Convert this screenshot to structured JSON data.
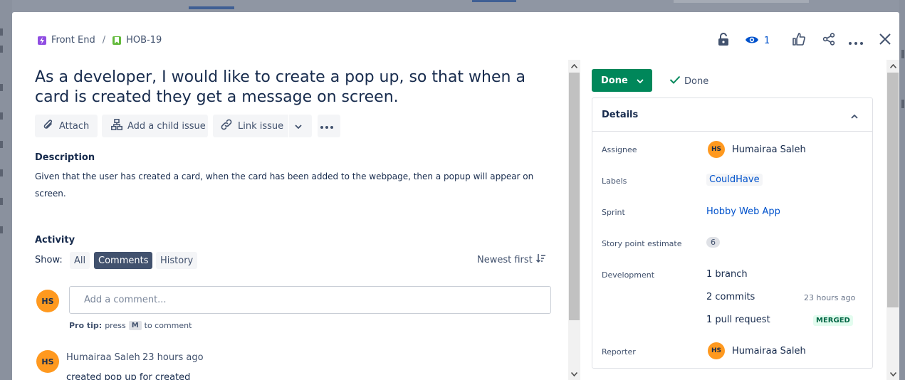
{
  "breadcrumb": {
    "project": "Front End",
    "separator": "/",
    "issue_key": "HOB-19"
  },
  "header_actions": {
    "watch_count": "1"
  },
  "issue": {
    "title": "As a developer, I would like to create a pop up, so that when a card is created they get a message on screen."
  },
  "toolbar": {
    "attach": "Attach",
    "add_child": "Add a child issue",
    "link_issue": "Link issue"
  },
  "description": {
    "heading": "Description",
    "text": "Given that the user has created a card, when the card has been added to the webpage, then a popup will appear on screen."
  },
  "activity": {
    "heading": "Activity",
    "show_label": "Show:",
    "filters": [
      "All",
      "Comments",
      "History"
    ],
    "active_filter": "Comments",
    "sort": "Newest first",
    "comment_placeholder": "Add a comment...",
    "protip_prefix": "Pro tip:",
    "protip_press": "press",
    "protip_key": "M",
    "protip_suffix": "to comment",
    "current_user_initials": "HS",
    "comments": [
      {
        "initials": "HS",
        "author": "Humairaa Saleh",
        "time": "23 hours ago",
        "body": "created pop up for created"
      }
    ]
  },
  "status": {
    "label": "Done",
    "resolution": "Done",
    "color": "#00875a"
  },
  "details": {
    "heading": "Details",
    "assignee_label": "Assignee",
    "assignee_initials": "HS",
    "assignee": "Humairaa Saleh",
    "labels_label": "Labels",
    "label_value": "CouldHave",
    "sprint_label": "Sprint",
    "sprint": "Hobby Web App",
    "story_points_label": "Story point estimate",
    "story_points": "6",
    "development_label": "Development",
    "branch": "1 branch",
    "commits": "2 commits",
    "commits_time": "23 hours ago",
    "pull_request": "1 pull request",
    "pr_status": "MERGED",
    "reporter_label": "Reporter",
    "reporter_initials": "HS",
    "reporter": "Humairaa Saleh"
  },
  "colors": {
    "avatar": "#ff991f",
    "link": "#0052cc",
    "merged": "#006644"
  }
}
